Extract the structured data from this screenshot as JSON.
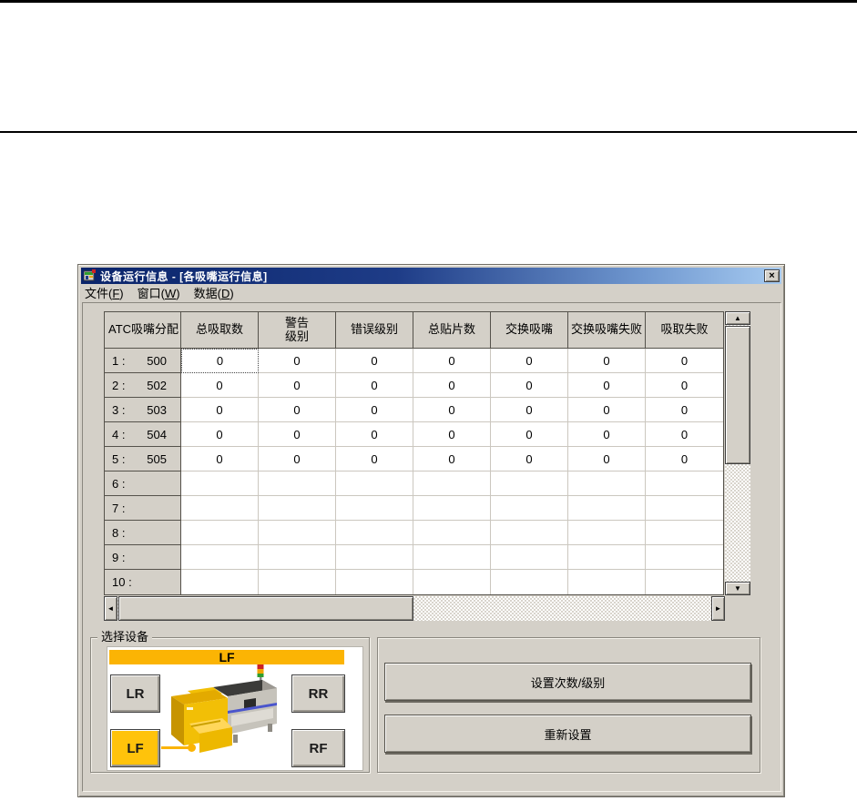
{
  "window": {
    "title": "设备运行信息 - [各吸嘴运行信息]",
    "close_glyph": "×"
  },
  "menu": {
    "items": [
      {
        "pre": "文件(",
        "key": "F",
        "post": ")"
      },
      {
        "pre": "窗口(",
        "key": "W",
        "post": ")"
      },
      {
        "pre": "数据(",
        "key": "D",
        "post": ")"
      }
    ]
  },
  "table": {
    "corner_header": "ATC吸嘴分配",
    "columns": [
      "总吸取数",
      "警告\n级别",
      "错误级别",
      "总贴片数",
      "交换吸嘴",
      "交换吸嘴失败",
      "吸取失败"
    ],
    "selection": {
      "row": 0,
      "col": 0
    },
    "rows": [
      {
        "label": "1 :",
        "nozzle": "500",
        "values": [
          "0",
          "0",
          "0",
          "0",
          "0",
          "0",
          "0"
        ]
      },
      {
        "label": "2 :",
        "nozzle": "502",
        "values": [
          "0",
          "0",
          "0",
          "0",
          "0",
          "0",
          "0"
        ]
      },
      {
        "label": "3 :",
        "nozzle": "503",
        "values": [
          "0",
          "0",
          "0",
          "0",
          "0",
          "0",
          "0"
        ]
      },
      {
        "label": "4 :",
        "nozzle": "504",
        "values": [
          "0",
          "0",
          "0",
          "0",
          "0",
          "0",
          "0"
        ]
      },
      {
        "label": "5 :",
        "nozzle": "505",
        "values": [
          "0",
          "0",
          "0",
          "0",
          "0",
          "0",
          "0"
        ]
      },
      {
        "label": "6 :",
        "nozzle": "",
        "values": [
          "",
          "",
          "",
          "",
          "",
          "",
          ""
        ]
      },
      {
        "label": "7 :",
        "nozzle": "",
        "values": [
          "",
          "",
          "",
          "",
          "",
          "",
          ""
        ]
      },
      {
        "label": "8 :",
        "nozzle": "",
        "values": [
          "",
          "",
          "",
          "",
          "",
          "",
          ""
        ]
      },
      {
        "label": "9 :",
        "nozzle": "",
        "values": [
          "",
          "",
          "",
          "",
          "",
          "",
          ""
        ]
      },
      {
        "label": "10 :",
        "nozzle": "",
        "values": [
          "",
          "",
          "",
          "",
          "",
          "",
          ""
        ]
      }
    ]
  },
  "scrollbar": {
    "up": "▲",
    "down": "▼",
    "left": "◄",
    "right": "►"
  },
  "device_panel": {
    "group_title": "选择设备",
    "selected_device_label": "LF",
    "buttons": [
      {
        "label": "LR",
        "selected": false
      },
      {
        "label": "RR",
        "selected": false
      },
      {
        "label": "LF",
        "selected": true
      },
      {
        "label": "RF",
        "selected": false
      }
    ]
  },
  "actions": {
    "set_count_level_label": "设置次数/级别",
    "reset_label": "重新设置"
  },
  "colors": {
    "chrome": "#D4D0C8",
    "titlebar_gradient_start": "#0A246A",
    "titlebar_gradient_end": "#A6CAF0",
    "accent_orange_bar": "#FBB404",
    "accent_orange_button": "#FFC30B"
  }
}
